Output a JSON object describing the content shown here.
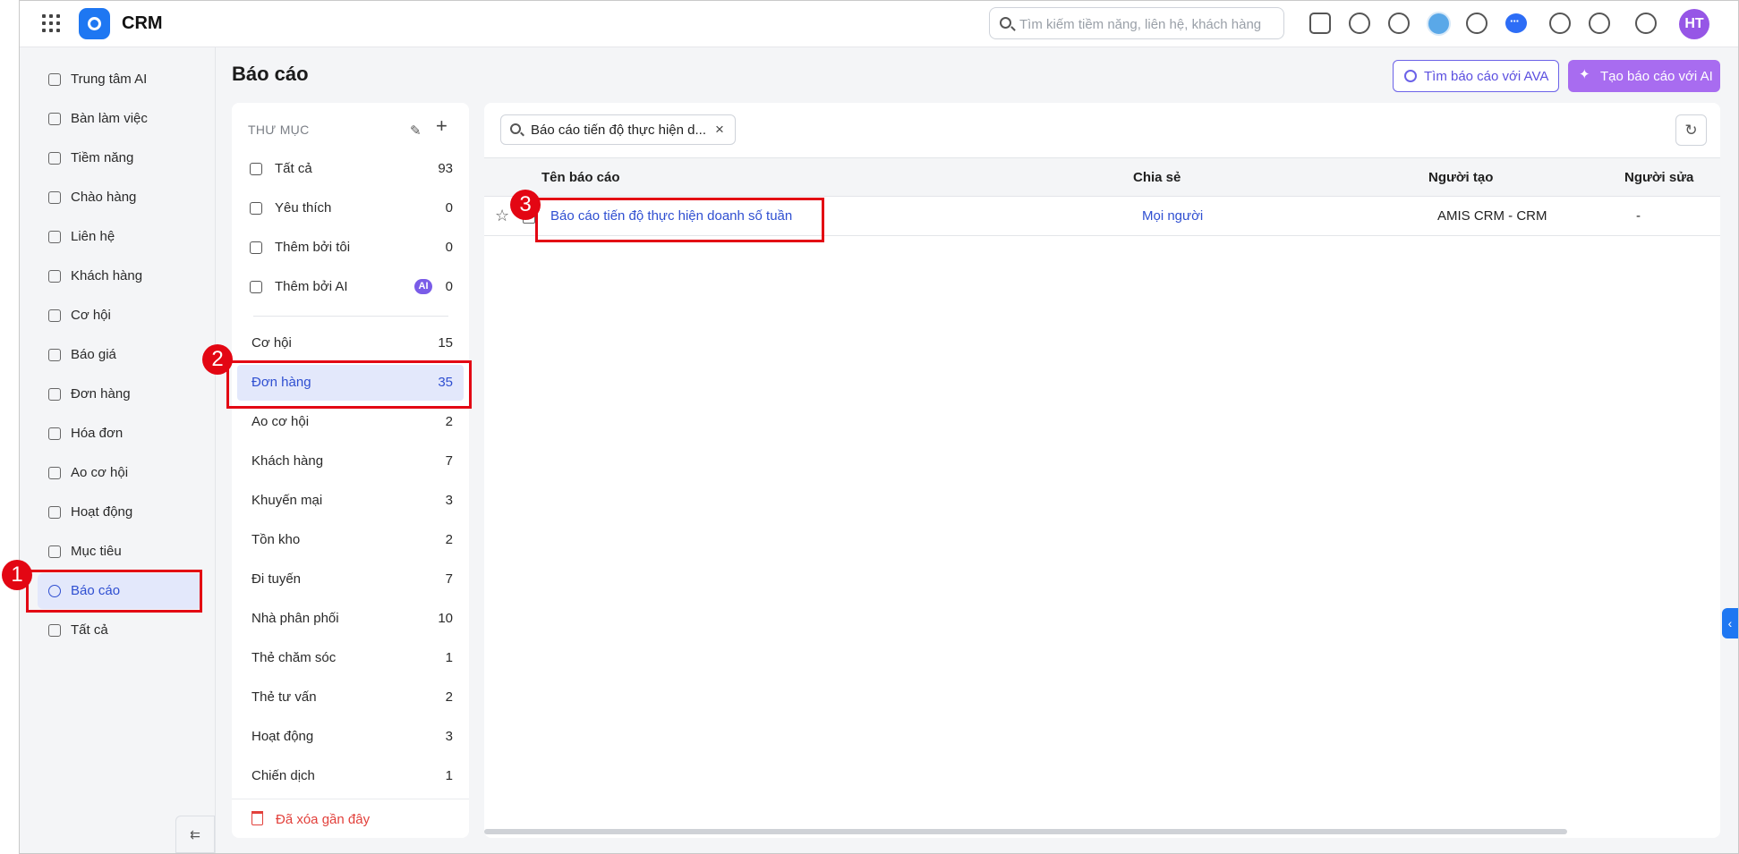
{
  "header": {
    "app_name": "CRM",
    "search_placeholder": "Tìm kiếm tiềm năng, liên hệ, khách hàng",
    "user_initials": "HT"
  },
  "sidebar": {
    "items": [
      {
        "label": "Trung tâm AI",
        "icon": "sparkle-icon"
      },
      {
        "label": "Bàn làm việc",
        "icon": "home-icon"
      },
      {
        "label": "Tiềm năng",
        "icon": "prospect-icon"
      },
      {
        "label": "Chào hàng",
        "icon": "magnet-icon"
      },
      {
        "label": "Liên hệ",
        "icon": "contact-icon"
      },
      {
        "label": "Khách hàng",
        "icon": "building-icon"
      },
      {
        "label": "Cơ hội",
        "icon": "opportunity-icon"
      },
      {
        "label": "Báo giá",
        "icon": "quote-icon"
      },
      {
        "label": "Đơn hàng",
        "icon": "cart-icon"
      },
      {
        "label": "Hóa đơn",
        "icon": "invoice-icon"
      },
      {
        "label": "Ao cơ hội",
        "icon": "pool-icon"
      },
      {
        "label": "Hoạt động",
        "icon": "activity-icon"
      },
      {
        "label": "Mục tiêu",
        "icon": "target-icon"
      },
      {
        "label": "Báo cáo",
        "icon": "pie-chart-icon",
        "active": true
      },
      {
        "label": "Tất cả",
        "icon": "menu-icon"
      }
    ]
  },
  "page": {
    "title": "Báo cáo",
    "ava_button": "Tìm báo cáo với AVA",
    "ai_button": "Tạo báo cáo với AI"
  },
  "folders": {
    "header": "THƯ MỤC",
    "pinned": [
      {
        "label": "Tất cả",
        "count": "93",
        "icon": "grid-icon"
      },
      {
        "label": "Yêu thích",
        "count": "0",
        "icon": "star-icon"
      },
      {
        "label": "Thêm bởi tôi",
        "count": "0",
        "icon": "user-add-icon"
      },
      {
        "label": "Thêm bởi AI",
        "count": "0",
        "icon": "sparkle-icon",
        "badge": "AI"
      }
    ],
    "items": [
      {
        "label": "Cơ hội",
        "count": "15"
      },
      {
        "label": "Đơn hàng",
        "count": "35",
        "selected": true
      },
      {
        "label": "Ao cơ hội",
        "count": "2"
      },
      {
        "label": "Khách hàng",
        "count": "7"
      },
      {
        "label": "Khuyến mại",
        "count": "3"
      },
      {
        "label": "Tồn kho",
        "count": "2"
      },
      {
        "label": "Đi tuyến",
        "count": "7"
      },
      {
        "label": "Nhà phân phối",
        "count": "10"
      },
      {
        "label": "Thẻ chăm sóc",
        "count": "1"
      },
      {
        "label": "Thẻ tư vấn",
        "count": "2"
      },
      {
        "label": "Hoạt động",
        "count": "3"
      },
      {
        "label": "Chiến dịch",
        "count": "1"
      }
    ],
    "trash": "Đã xóa gần đây"
  },
  "filter": {
    "chip": "Báo cáo tiến độ thực hiện d..."
  },
  "table": {
    "columns": [
      "Tên báo cáo",
      "Chia sẻ",
      "Người tạo",
      "Người sửa"
    ],
    "rows": [
      {
        "name": "Báo cáo tiến độ thực hiện doanh số tuần",
        "share": "Mọi người",
        "creator": "AMIS CRM - CRM",
        "editor": "-"
      }
    ]
  },
  "annotations": {
    "m1": "1",
    "m2": "2",
    "m3": "3"
  },
  "colors": {
    "accent": "#2f4fd1",
    "highlight": "#e30613",
    "ai_purple": "#a86cf0"
  }
}
